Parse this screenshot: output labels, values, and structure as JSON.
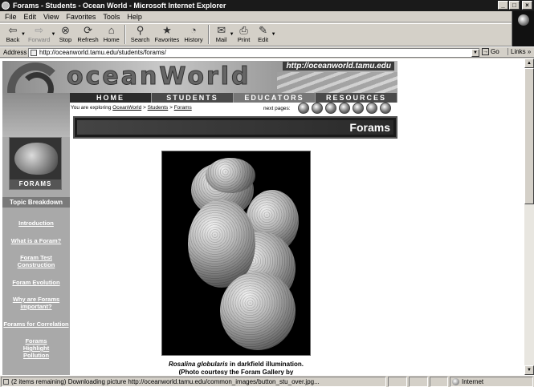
{
  "window": {
    "title": "Forams - Students - Ocean World - Microsoft Internet Explorer",
    "controls": {
      "minimize": "_",
      "maximize": "□",
      "close": "×"
    }
  },
  "menu": [
    "File",
    "Edit",
    "View",
    "Favorites",
    "Tools",
    "Help"
  ],
  "toolbar": {
    "back": "Back",
    "forward": "Forward",
    "stop": "Stop",
    "refresh": "Refresh",
    "home": "Home",
    "search": "Search",
    "favorites": "Favorites",
    "history": "History",
    "mail": "Mail",
    "print": "Print",
    "edit": "Edit"
  },
  "address": {
    "label": "Address",
    "url": "http://oceanworld.tamu.edu/students/forams/",
    "go": "Go",
    "links": "Links"
  },
  "site": {
    "logo": "oceanWorld",
    "header_url": "http://oceanworld.tamu.edu",
    "nav": [
      "HOME",
      "STUDENTS",
      "EDUCATORS",
      "RESOURCES"
    ],
    "crumb_prefix": "You are exploring",
    "crumb": [
      "OceanWorld",
      "Students",
      "Forams"
    ],
    "crumb_sep": ">",
    "next_pages": "next pages:",
    "section_title": "Forams",
    "side_image_caption": "FORAMS",
    "topic_heading": "Topic Breakdown",
    "topics": [
      "Introduction",
      "What is a Foram?",
      "Foram Test Construction",
      "Foram Evolution",
      "Why are Forams important?",
      "Forams for Correlation",
      "Forams Highlight Pollution"
    ],
    "caption_species": "Rosalina globularis",
    "caption_rest": " in darkfield illumination.",
    "caption_line2_prefix": "(Photo courtesy the ",
    "caption_link": "Foram Gallery",
    "caption_line2_suffix": " by"
  },
  "status": {
    "text": "(2 items remaining) Downloading picture http://oceanworld.tamu.edu/common_images/button_stu_over.jpg...",
    "zone": "Internet"
  }
}
